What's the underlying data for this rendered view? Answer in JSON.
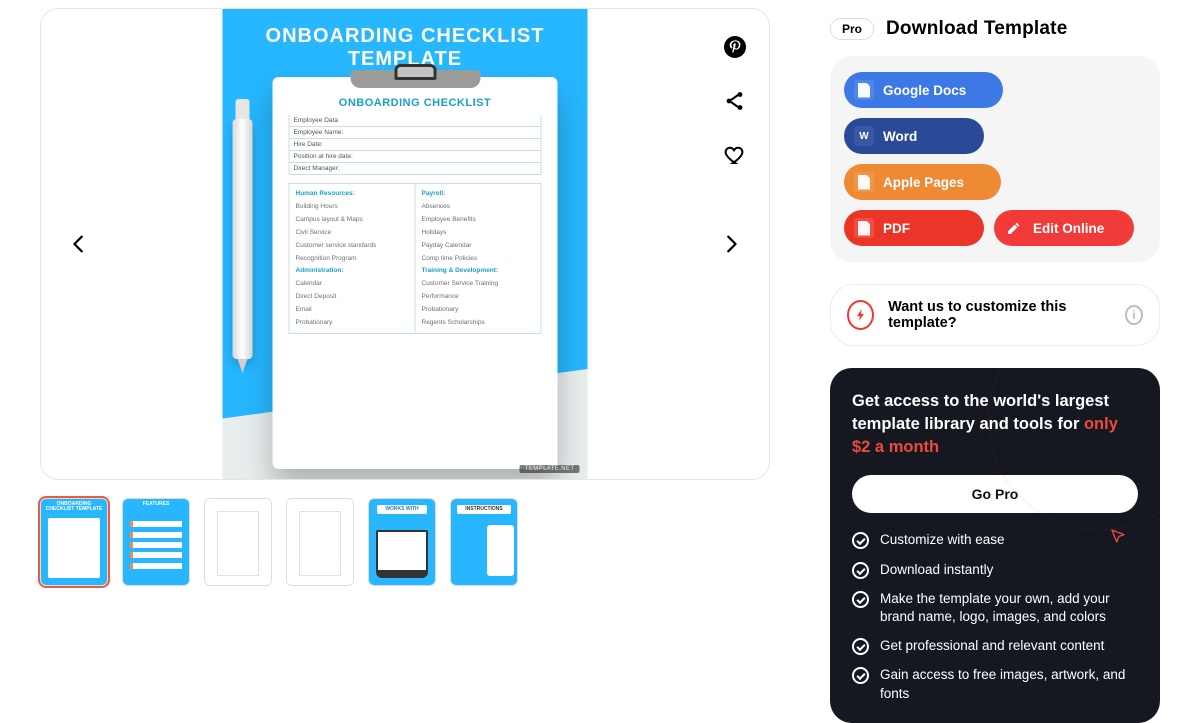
{
  "header": {
    "pro_badge": "Pro",
    "title": "Download Template"
  },
  "downloads": {
    "gdocs": "Google Docs",
    "word": "Word",
    "pages": "Apple Pages",
    "pdf": "PDF",
    "edit": "Edit Online"
  },
  "customize": {
    "text": "Want us to customize this template?"
  },
  "pro": {
    "headline_a": "Get access to the world's largest template library and tools for ",
    "headline_price": "only $2 a month",
    "cta": "Go Pro",
    "features": [
      "Customize with ease",
      "Download instantly",
      "Make the template your own, add your brand name, logo, images, and colors",
      "Get professional and relevant content",
      "Gain access to free images, artwork, and fonts"
    ]
  },
  "slide": {
    "banner": "ONBOARDING CHECKLIST TEMPLATE",
    "doc_title": "ONBOARDING CHECKLIST",
    "employee_rows": [
      "Employee Data",
      "Employee Name:",
      "Hire Date:",
      "Position at hire date:",
      "Direct Manager:"
    ],
    "col1": {
      "s1": "Human Resources:",
      "i1": [
        "Building Hours",
        "Campus layout & Maps",
        "Civil Service",
        "Customer service standards",
        "Recognition Program"
      ],
      "s2": "Administration:",
      "i2": [
        "Calendar",
        "Direct Deposit",
        "Email",
        "Probationary"
      ]
    },
    "col2": {
      "s1": "Payroll:",
      "i1": [
        "Absences",
        "Employee Benefits",
        "Holidays",
        "Payday Calendar",
        "Comp time Policies"
      ],
      "s2": "Training & Development:",
      "i2": [
        "Customer Service Training",
        "Performance",
        "Probationary",
        "Regents Scholarships"
      ]
    },
    "brand": "TEMPLATE.NET"
  },
  "thumbs": {
    "t1": "ONBOARDING CHECKLIST TEMPLATE",
    "t2": "FEATURES",
    "t5": "WORKS WITH",
    "t6": "INSTRUCTIONS"
  }
}
